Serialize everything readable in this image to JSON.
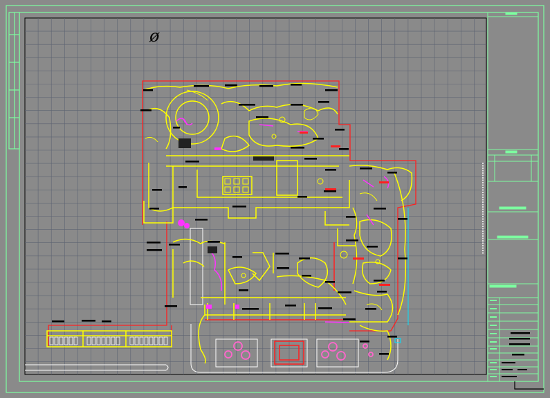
{
  "drawing": {
    "north_symbol": "ø",
    "colors": {
      "background": "#8a8a8a",
      "frame": "#7dffa0",
      "grid": "#5c6372",
      "boundary": "#ff2020",
      "planting": "#ffff00",
      "labels": "#000000",
      "accent": "#ff33ff",
      "water": "#00e0ff",
      "outline": "#ffffff"
    }
  }
}
